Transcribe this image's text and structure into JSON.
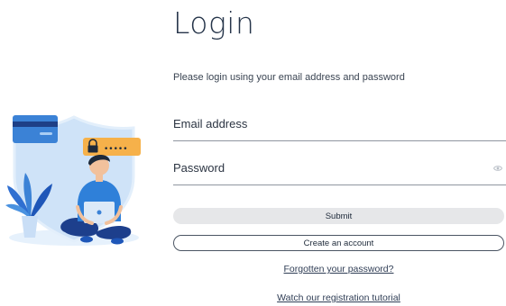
{
  "page": {
    "title": "Login",
    "subtitle": "Please login using your email address and password"
  },
  "form": {
    "email_placeholder": "Email address",
    "password_placeholder": "Password",
    "submit_label": "Submit",
    "create_account_label": "Create an account",
    "forgot_password_link": "Forgotten your password?",
    "tutorial_link": "Watch our registration tutorial"
  },
  "illustration": {
    "password_mask": "•••••"
  },
  "colors": {
    "shield": "#cfe3f8",
    "card": "#3b82d6",
    "badge": "#f6b14a",
    "plant": "#2f6fd1",
    "shirt": "#2f80d9",
    "trousers": "#1d3f8c",
    "button_fill": "#e6e7e9",
    "text": "#1e2a3a"
  }
}
